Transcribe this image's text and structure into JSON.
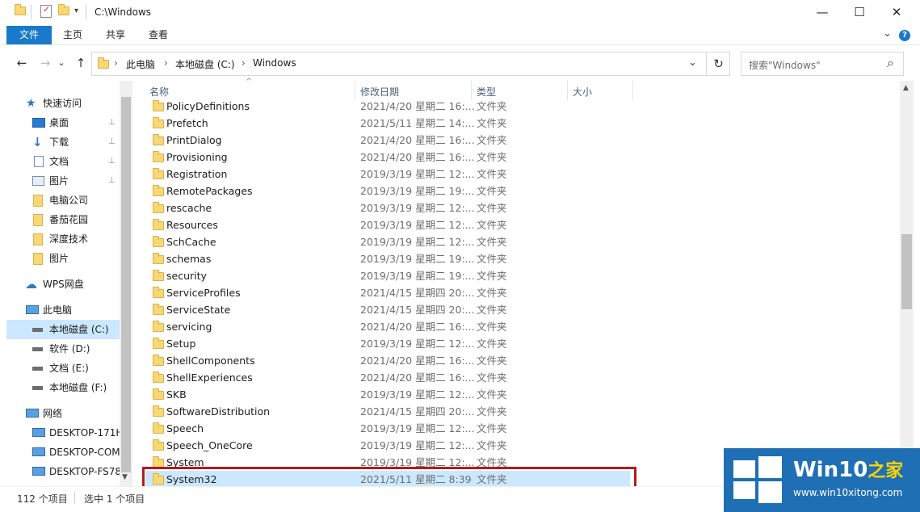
{
  "titlebar": {
    "path": "C:\\Windows",
    "minimize": "—",
    "maximize": "☐",
    "close": "✕"
  },
  "ribbon": {
    "tabs": [
      "文件",
      "主页",
      "共享",
      "查看"
    ],
    "expand": "⌄",
    "help": "?"
  },
  "nav": {
    "back": "←",
    "forward": "→",
    "history": "⌄",
    "up": "↑"
  },
  "address": {
    "segments": [
      "此电脑",
      "本地磁盘 (C:)",
      "Windows"
    ],
    "sep": "›",
    "dropdown": "⌄"
  },
  "refresh": "↻",
  "search": {
    "placeholder": "搜索\"Windows\"",
    "icon": "⌕"
  },
  "navpane": {
    "quick_access": "快速访问",
    "items": [
      {
        "label": "桌面",
        "icon": "desktop-icon",
        "pinned": true
      },
      {
        "label": "下载",
        "icon": "download-icon",
        "pinned": true
      },
      {
        "label": "文档",
        "icon": "document-icon",
        "pinned": true
      },
      {
        "label": "图片",
        "icon": "picture-icon",
        "pinned": true
      },
      {
        "label": "电脑公司",
        "icon": "folder-icon",
        "pinned": false
      },
      {
        "label": "番茄花园",
        "icon": "folder-icon",
        "pinned": false
      },
      {
        "label": "深度技术",
        "icon": "folder-icon",
        "pinned": false
      },
      {
        "label": "图片",
        "icon": "folder-icon",
        "pinned": false
      }
    ],
    "wps": "WPS网盘",
    "this_pc": "此电脑",
    "drives": [
      "本地磁盘 (C:)",
      "软件 (D:)",
      "文档 (E:)",
      "本地磁盘 (F:)"
    ],
    "network": "网络",
    "computers": [
      "DESKTOP-171H",
      "DESKTOP-COM",
      "DESKTOP-FS78"
    ],
    "pin_glyph": "📌"
  },
  "columns": {
    "name": "名称",
    "modified": "修改日期",
    "type": "类型",
    "size": "大小",
    "sort_glyph": "^"
  },
  "files": [
    {
      "name": "PolicyDefinitions",
      "date": "2021/4/20 星期二 16:...",
      "type": "文件夹"
    },
    {
      "name": "Prefetch",
      "date": "2021/5/11 星期二 14:...",
      "type": "文件夹"
    },
    {
      "name": "PrintDialog",
      "date": "2021/4/20 星期二 16:...",
      "type": "文件夹"
    },
    {
      "name": "Provisioning",
      "date": "2021/4/20 星期二 16:...",
      "type": "文件夹"
    },
    {
      "name": "Registration",
      "date": "2019/3/19 星期二 12:...",
      "type": "文件夹"
    },
    {
      "name": "RemotePackages",
      "date": "2019/3/19 星期二 19:...",
      "type": "文件夹"
    },
    {
      "name": "rescache",
      "date": "2019/3/19 星期二 12:...",
      "type": "文件夹"
    },
    {
      "name": "Resources",
      "date": "2019/3/19 星期二 12:...",
      "type": "文件夹"
    },
    {
      "name": "SchCache",
      "date": "2019/3/19 星期二 12:...",
      "type": "文件夹"
    },
    {
      "name": "schemas",
      "date": "2019/3/19 星期二 19:...",
      "type": "文件夹"
    },
    {
      "name": "security",
      "date": "2019/3/19 星期二 19:...",
      "type": "文件夹"
    },
    {
      "name": "ServiceProfiles",
      "date": "2021/4/15 星期四 20:...",
      "type": "文件夹"
    },
    {
      "name": "ServiceState",
      "date": "2021/4/15 星期四 20:...",
      "type": "文件夹"
    },
    {
      "name": "servicing",
      "date": "2021/4/20 星期二 16:...",
      "type": "文件夹"
    },
    {
      "name": "Setup",
      "date": "2019/3/19 星期二 12:...",
      "type": "文件夹"
    },
    {
      "name": "ShellComponents",
      "date": "2021/4/20 星期二 16:...",
      "type": "文件夹"
    },
    {
      "name": "ShellExperiences",
      "date": "2021/4/20 星期二 16:...",
      "type": "文件夹"
    },
    {
      "name": "SKB",
      "date": "2019/3/19 星期二 12:...",
      "type": "文件夹"
    },
    {
      "name": "SoftwareDistribution",
      "date": "2021/4/15 星期四 20:...",
      "type": "文件夹"
    },
    {
      "name": "Speech",
      "date": "2019/3/19 星期二 12:...",
      "type": "文件夹"
    },
    {
      "name": "Speech_OneCore",
      "date": "2019/3/19 星期二 12:...",
      "type": "文件夹"
    },
    {
      "name": "System",
      "date": "2019/3/19 星期二 12:...",
      "type": "文件夹"
    },
    {
      "name": "System32",
      "date": "2021/5/11 星期二 8:39",
      "type": "文件夹",
      "selected": true
    }
  ],
  "status": {
    "count": "112 个项目",
    "selected": "选中 1 个项目"
  },
  "watermark": {
    "brand": "Win10",
    "suffix": "之家",
    "url": "www.win10xitong.com"
  },
  "colors": {
    "accent": "#1979ca",
    "selection": "#cce8ff",
    "highlight_frame": "#b41a1a",
    "watermark_bg": "#1f6fb5"
  }
}
